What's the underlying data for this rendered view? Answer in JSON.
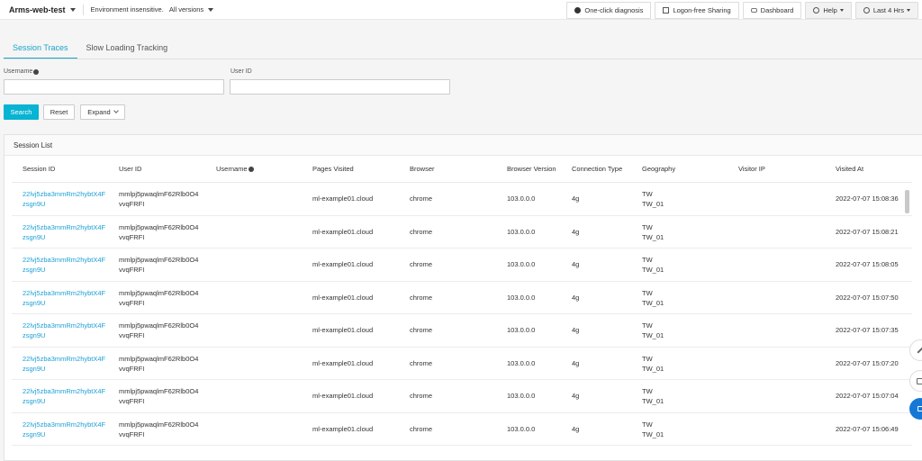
{
  "topbar": {
    "app_name": "Arms-web-test",
    "environment": "Environment insensitive.",
    "versions": "All versions",
    "buttons": {
      "diagnosis": "One-click diagnosis",
      "sharing": "Logon-free Sharing",
      "dashboard": "Dashboard",
      "help": "Help",
      "time_range": "Last 4 Hrs"
    }
  },
  "tabs": [
    "Session Traces",
    "Slow Loading Tracking"
  ],
  "filters": {
    "username_label": "Username",
    "userid_label": "User ID",
    "username_value": "",
    "userid_value": ""
  },
  "actions": {
    "search": "Search",
    "reset": "Reset",
    "expand": "Expand"
  },
  "session_list": {
    "title": "Session List",
    "columns": [
      "Session ID",
      "User ID",
      "Username",
      "Pages Visited",
      "Browser",
      "Browser Version",
      "Connection Type",
      "Geography",
      "Visitor IP",
      "Visited At"
    ],
    "rows": [
      {
        "session_id": [
          "22lvj5zba3mmRm2hybtX4F",
          "zsgn9U"
        ],
        "user_id": [
          "mmlpj5pwaqlmF62Rlb0O4",
          "vvqFRFI"
        ],
        "username": "",
        "pages": "ml-example01.cloud",
        "browser": "chrome",
        "version": "103.0.0.0",
        "connection": "4g",
        "geo": [
          "TW",
          "TW_01"
        ],
        "ip": "",
        "visited_at": "2022-07-07 15:08:36"
      },
      {
        "session_id": [
          "22lvj5zba3mmRm2hybtX4F",
          "zsgn9U"
        ],
        "user_id": [
          "mmlpj5pwaqlmF62Rlb0O4",
          "vvqFRFI"
        ],
        "username": "",
        "pages": "ml-example01.cloud",
        "browser": "chrome",
        "version": "103.0.0.0",
        "connection": "4g",
        "geo": [
          "TW",
          "TW_01"
        ],
        "ip": "",
        "visited_at": "2022-07-07 15:08:21"
      },
      {
        "session_id": [
          "22lvj5zba3mmRm2hybtX4F",
          "zsgn9U"
        ],
        "user_id": [
          "mmlpj5pwaqlmF62Rlb0O4",
          "vvqFRFI"
        ],
        "username": "",
        "pages": "ml-example01.cloud",
        "browser": "chrome",
        "version": "103.0.0.0",
        "connection": "4g",
        "geo": [
          "TW",
          "TW_01"
        ],
        "ip": "",
        "visited_at": "2022-07-07 15:08:05"
      },
      {
        "session_id": [
          "22lvj5zba3mmRm2hybtX4F",
          "zsgn9U"
        ],
        "user_id": [
          "mmlpj5pwaqlmF62Rlb0O4",
          "vvqFRFI"
        ],
        "username": "",
        "pages": "ml-example01.cloud",
        "browser": "chrome",
        "version": "103.0.0.0",
        "connection": "4g",
        "geo": [
          "TW",
          "TW_01"
        ],
        "ip": "",
        "visited_at": "2022-07-07 15:07:50"
      },
      {
        "session_id": [
          "22lvj5zba3mmRm2hybtX4F",
          "zsgn9U"
        ],
        "user_id": [
          "mmlpj5pwaqlmF62Rlb0O4",
          "vvqFRFI"
        ],
        "username": "",
        "pages": "ml-example01.cloud",
        "browser": "chrome",
        "version": "103.0.0.0",
        "connection": "4g",
        "geo": [
          "TW",
          "TW_01"
        ],
        "ip": "",
        "visited_at": "2022-07-07 15:07:35"
      },
      {
        "session_id": [
          "22lvj5zba3mmRm2hybtX4F",
          "zsgn9U"
        ],
        "user_id": [
          "mmlpj5pwaqlmF62Rlb0O4",
          "vvqFRFI"
        ],
        "username": "",
        "pages": "ml-example01.cloud",
        "browser": "chrome",
        "version": "103.0.0.0",
        "connection": "4g",
        "geo": [
          "TW",
          "TW_01"
        ],
        "ip": "",
        "visited_at": "2022-07-07 15:07:20"
      },
      {
        "session_id": [
          "22lvj5zba3mmRm2hybtX4F",
          "zsgn9U"
        ],
        "user_id": [
          "mmlpj5pwaqlmF62Rlb0O4",
          "vvqFRFI"
        ],
        "username": "",
        "pages": "ml-example01.cloud",
        "browser": "chrome",
        "version": "103.0.0.0",
        "connection": "4g",
        "geo": [
          "TW",
          "TW_01"
        ],
        "ip": "",
        "visited_at": "2022-07-07 15:07:04"
      },
      {
        "session_id": [
          "22lvj5zba3mmRm2hybtX4F",
          "zsgn9U"
        ],
        "user_id": [
          "mmlpj5pwaqlmF62Rlb0O4",
          "vvqFRFI"
        ],
        "username": "",
        "pages": "ml-example01.cloud",
        "browser": "chrome",
        "version": "103.0.0.0",
        "connection": "4g",
        "geo": [
          "TW",
          "TW_01"
        ],
        "ip": "",
        "visited_at": "2022-07-07 15:06:49"
      }
    ]
  }
}
